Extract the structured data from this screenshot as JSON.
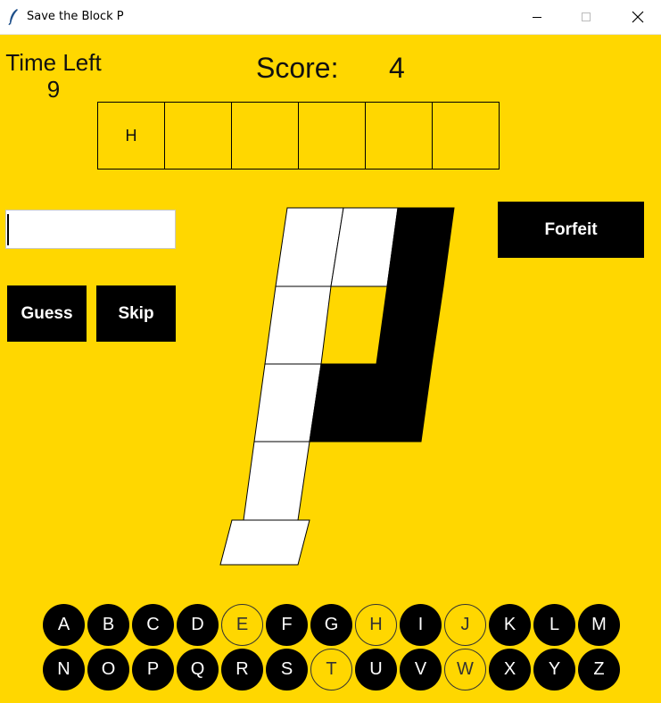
{
  "window": {
    "title": "Save the Block P",
    "icon": "feather-icon",
    "controls": [
      "minimize",
      "maximize",
      "close"
    ]
  },
  "colors": {
    "background": "#ffd700",
    "button": "#000000",
    "button_text": "#ffffff",
    "block_filled": "#000000",
    "block_safe": "#ffffff"
  },
  "hud": {
    "time_label": "Time Left",
    "time_value": "9",
    "score_label": "Score:",
    "score_value": "4"
  },
  "word_slots": [
    "H",
    "",
    "",
    "",
    "",
    ""
  ],
  "input": {
    "value": "",
    "placeholder": ""
  },
  "buttons": {
    "guess": "Guess",
    "skip": "Skip",
    "forfeit": "Forfeit"
  },
  "block_p": {
    "description_hidden": false,
    "cells": [
      {
        "id": "top-left",
        "state": "safe"
      },
      {
        "id": "top-middle",
        "state": "safe"
      },
      {
        "id": "top-right",
        "state": "filled"
      },
      {
        "id": "row2-left",
        "state": "safe"
      },
      {
        "id": "row2-right",
        "state": "filled"
      },
      {
        "id": "row3-left",
        "state": "safe"
      },
      {
        "id": "row3-middle",
        "state": "filled"
      },
      {
        "id": "row3-right",
        "state": "filled"
      },
      {
        "id": "row4-left",
        "state": "safe"
      },
      {
        "id": "foot",
        "state": "safe"
      }
    ]
  },
  "keyboard": {
    "row1": [
      {
        "letter": "A",
        "used": false
      },
      {
        "letter": "B",
        "used": false
      },
      {
        "letter": "C",
        "used": false
      },
      {
        "letter": "D",
        "used": false
      },
      {
        "letter": "E",
        "used": true
      },
      {
        "letter": "F",
        "used": false
      },
      {
        "letter": "G",
        "used": false
      },
      {
        "letter": "H",
        "used": true
      },
      {
        "letter": "I",
        "used": false
      },
      {
        "letter": "J",
        "used": true
      },
      {
        "letter": "K",
        "used": false
      },
      {
        "letter": "L",
        "used": false
      },
      {
        "letter": "M",
        "used": false
      }
    ],
    "row2": [
      {
        "letter": "N",
        "used": false
      },
      {
        "letter": "O",
        "used": false
      },
      {
        "letter": "P",
        "used": false
      },
      {
        "letter": "Q",
        "used": false
      },
      {
        "letter": "R",
        "used": false
      },
      {
        "letter": "S",
        "used": false
      },
      {
        "letter": "T",
        "used": true
      },
      {
        "letter": "U",
        "used": false
      },
      {
        "letter": "V",
        "used": false
      },
      {
        "letter": "W",
        "used": true
      },
      {
        "letter": "X",
        "used": false
      },
      {
        "letter": "Y",
        "used": false
      },
      {
        "letter": "Z",
        "used": false
      }
    ]
  }
}
